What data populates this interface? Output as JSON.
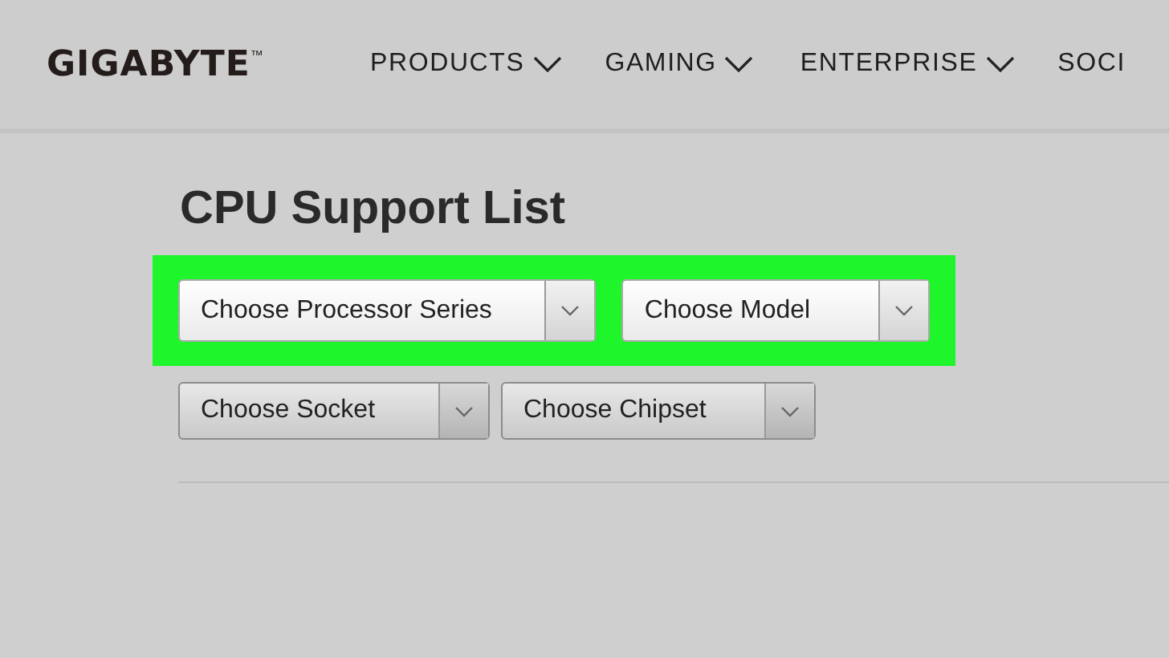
{
  "header": {
    "logo": "GIGABYTE",
    "trademark": "™",
    "nav": [
      {
        "label": "PRODUCTS",
        "has_menu": true
      },
      {
        "label": "GAMING",
        "has_menu": true
      },
      {
        "label": "ENTERPRISE",
        "has_menu": true
      },
      {
        "label": "SOCI",
        "has_menu": false
      }
    ]
  },
  "title": "CPU Support List",
  "filter_rows": [
    {
      "highlighted": true,
      "dropdowns": [
        {
          "label": "Choose Processor Series"
        },
        {
          "label": "Choose Model"
        }
      ]
    },
    {
      "highlighted": false,
      "dropdowns": [
        {
          "label": "Choose Socket"
        },
        {
          "label": "Choose Chipset"
        }
      ]
    }
  ]
}
